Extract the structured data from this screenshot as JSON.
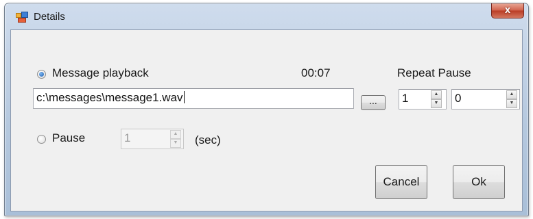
{
  "window": {
    "title": "Details",
    "close_symbol": "x",
    "app_icon": "form-window-icon"
  },
  "playback": {
    "radio_label": "Message playback",
    "selected": true,
    "duration": "00:07",
    "file_path": "c:\\messages\\message1.wav",
    "browse_label": "...",
    "repeat_pause_label": "Repeat Pause",
    "repeat_value": "1",
    "pause_value": "0"
  },
  "pause": {
    "radio_label": "Pause",
    "selected": false,
    "value": "1",
    "unit_label": "(sec)"
  },
  "buttons": {
    "cancel_label": "Cancel",
    "ok_label": "Ok"
  },
  "icons": {
    "spin_up": "▲",
    "spin_down": "▼"
  }
}
